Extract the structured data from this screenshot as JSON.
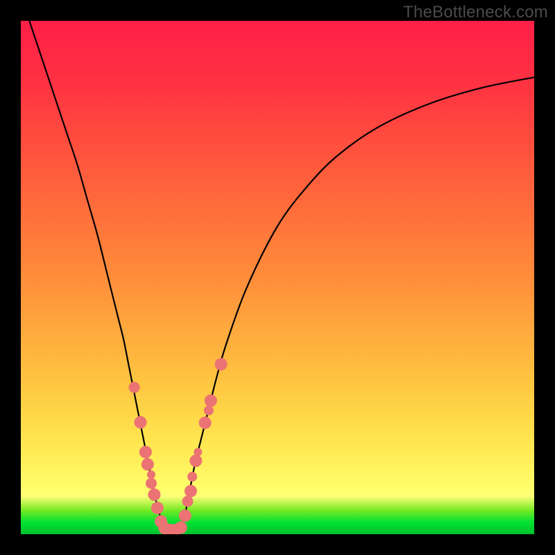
{
  "watermark": "TheBottleneck.com",
  "chart_data": {
    "type": "line",
    "title": "",
    "xlabel": "",
    "ylabel": "",
    "xlim": [
      0,
      100
    ],
    "ylim": [
      0,
      100
    ],
    "gradient_stops": [
      {
        "offset": 0.0,
        "color": "#00c12e"
      },
      {
        "offset": 0.023,
        "color": "#00e234"
      },
      {
        "offset": 0.046,
        "color": "#72ea22"
      },
      {
        "offset": 0.074,
        "color": "#feff78"
      },
      {
        "offset": 0.088,
        "color": "#fffe6b"
      },
      {
        "offset": 0.176,
        "color": "#ffe750"
      },
      {
        "offset": 0.3,
        "color": "#fec440"
      },
      {
        "offset": 0.5,
        "color": "#ff8d3a"
      },
      {
        "offset": 0.7,
        "color": "#ff5d3c"
      },
      {
        "offset": 0.88,
        "color": "#ff3242"
      },
      {
        "offset": 1.0,
        "color": "#ff1f47"
      }
    ],
    "series": [
      {
        "name": "bottleneck-curve",
        "x": [
          0,
          3,
          6,
          9,
          11,
          13,
          15,
          17,
          19,
          20,
          21,
          22,
          23,
          24,
          25,
          26,
          27,
          28,
          29,
          30,
          31,
          32,
          33,
          34,
          36,
          38,
          40,
          44,
          50,
          56,
          62,
          70,
          80,
          90,
          100
        ],
        "y": [
          105,
          96,
          87,
          78,
          72,
          65,
          58,
          50,
          42,
          38,
          33,
          28,
          23,
          18,
          13,
          8,
          4,
          1.2,
          0.3,
          0.3,
          1.2,
          4,
          9,
          14,
          22,
          30,
          37,
          48,
          60,
          68,
          74,
          79.5,
          84,
          87,
          89
        ]
      }
    ],
    "scatter": {
      "name": "samples",
      "color": "#eb7373",
      "points": [
        {
          "x": 22.1,
          "y": 28.6,
          "r": 8
        },
        {
          "x": 23.3,
          "y": 21.8,
          "r": 9
        },
        {
          "x": 24.3,
          "y": 16.0,
          "r": 9
        },
        {
          "x": 24.7,
          "y": 13.6,
          "r": 9
        },
        {
          "x": 25.4,
          "y": 11.6,
          "r": 6
        },
        {
          "x": 25.4,
          "y": 9.9,
          "r": 8
        },
        {
          "x": 26.0,
          "y": 7.7,
          "r": 9
        },
        {
          "x": 26.6,
          "y": 5.1,
          "r": 9
        },
        {
          "x": 27.3,
          "y": 2.5,
          "r": 9
        },
        {
          "x": 28.0,
          "y": 1.2,
          "r": 9
        },
        {
          "x": 29.1,
          "y": 0.8,
          "r": 9
        },
        {
          "x": 30.1,
          "y": 0.8,
          "r": 9
        },
        {
          "x": 31.2,
          "y": 1.3,
          "r": 9
        },
        {
          "x": 32.0,
          "y": 3.6,
          "r": 9
        },
        {
          "x": 32.5,
          "y": 6.4,
          "r": 8
        },
        {
          "x": 33.1,
          "y": 8.4,
          "r": 9
        },
        {
          "x": 33.4,
          "y": 11.2,
          "r": 7
        },
        {
          "x": 34.1,
          "y": 14.3,
          "r": 9
        },
        {
          "x": 34.5,
          "y": 16.0,
          "r": 6
        },
        {
          "x": 35.9,
          "y": 21.7,
          "r": 9
        },
        {
          "x": 36.6,
          "y": 24.1,
          "r": 7
        },
        {
          "x": 37.0,
          "y": 26.0,
          "r": 9
        },
        {
          "x": 39.0,
          "y": 33.1,
          "r": 9
        }
      ]
    }
  }
}
